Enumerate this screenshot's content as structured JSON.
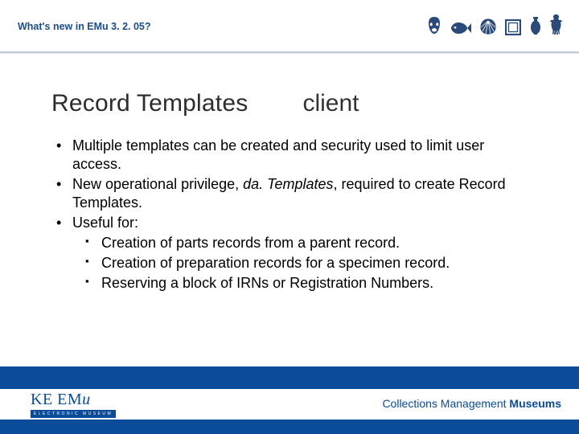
{
  "header": {
    "title": "What's new in EMu 3. 2. 05?"
  },
  "icons": [
    "mask-icon",
    "fish-icon",
    "shell-icon",
    "frame-icon",
    "vase-icon",
    "figure-icon"
  ],
  "title": {
    "main": "Record Templates",
    "sub": "client"
  },
  "bullets": {
    "b1a": "Multiple templates can be created and security used to limit user access.",
    "b1b_pre": "New operational privilege, ",
    "b1b_em": "da. Templates",
    "b1b_post": ", required to create Record Templates.",
    "b1c": "Useful for:",
    "b2a": "Creation of parts records from a parent record.",
    "b2b": "Creation of preparation records for a specimen record.",
    "b2c": "Reserving a block of IRNs or Registration Numbers."
  },
  "logo": {
    "text_a": "KE ",
    "text_b": "EM",
    "text_c": "u",
    "sub": "ELECTRONIC MUSEUM"
  },
  "footer": {
    "a": "Collections Management ",
    "b": "Museums"
  }
}
